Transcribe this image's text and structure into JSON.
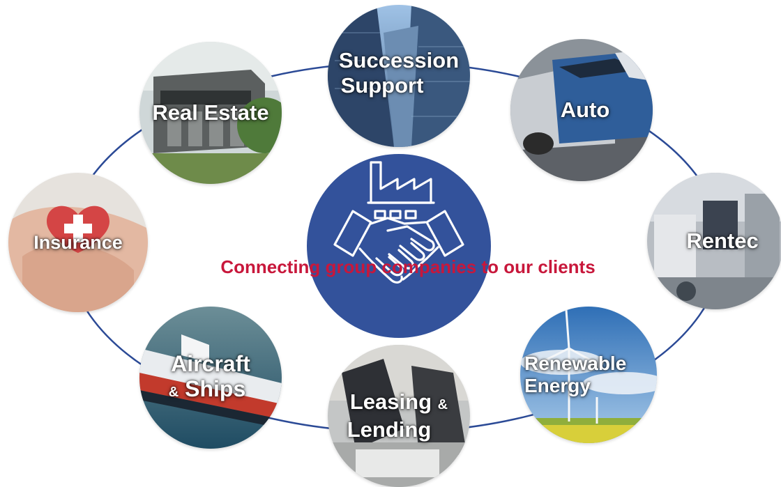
{
  "hub": {
    "tagline": "Connecting group companies to our clients",
    "icon": "factory-handshake-icon",
    "color": "#33529b"
  },
  "tagline_color": "#c8173b",
  "ring_color": "#2b4a96",
  "segments": [
    {
      "id": "succession",
      "line1": "Succession",
      "line2": "Support"
    },
    {
      "id": "auto",
      "line1": "Auto"
    },
    {
      "id": "rentec",
      "line1": "Rentec"
    },
    {
      "id": "renewable",
      "line1": "Renewable",
      "line2": "Energy"
    },
    {
      "id": "leasing",
      "line1": "Leasing",
      "amp": "&",
      "line2": "Lending"
    },
    {
      "id": "aircraft",
      "line1": "Aircraft",
      "amp": "&",
      "line2": "Ships"
    },
    {
      "id": "insurance",
      "line1": "Insurance"
    },
    {
      "id": "realestate",
      "line1": "Real Estate"
    }
  ]
}
